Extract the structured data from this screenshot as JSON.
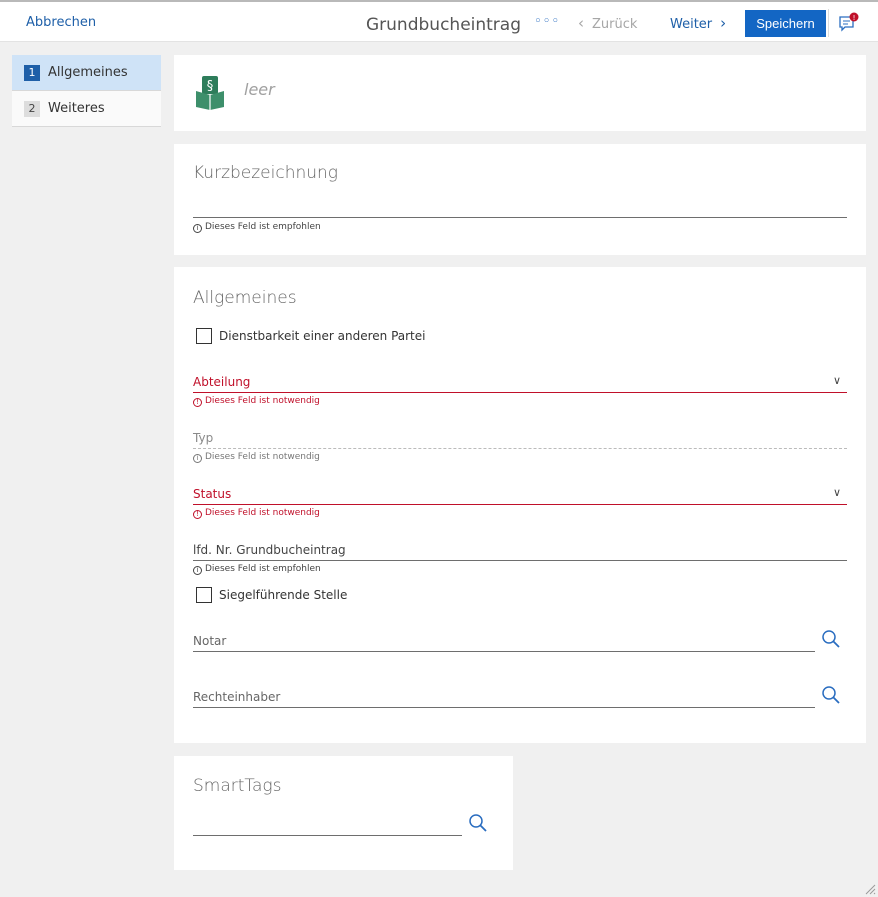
{
  "toolbar": {
    "cancel": "Abbrechen",
    "title": "Grundbucheintrag",
    "more": "◦◦◦",
    "back": "Zurück",
    "next": "Weiter",
    "save": "Speichern",
    "notification_badge": "!"
  },
  "nav": {
    "items": [
      {
        "num": "1",
        "label": "Allgemeines",
        "active": true
      },
      {
        "num": "2",
        "label": "Weiteres",
        "active": false
      }
    ]
  },
  "header_card": {
    "icon": "land-register-book-icon",
    "name_placeholder": "leer"
  },
  "short_name": {
    "title": "Kurzbezeichnung",
    "hint": "Dieses Feld ist empfohlen"
  },
  "general": {
    "title": "Allgemeines",
    "checkbox_easement": {
      "label": "Dienstbarkeit einer anderen Partei",
      "checked": false
    },
    "department": {
      "label": "Abteilung",
      "hint": "Dieses Feld ist notwendig"
    },
    "type": {
      "label": "Typ",
      "hint": "Dieses Feld ist notwendig"
    },
    "status": {
      "label": "Status",
      "hint": "Dieses Feld ist notwendig"
    },
    "entry_number": {
      "label": "lfd. Nr. Grundbucheintrag",
      "hint": "Dieses Feld ist empfohlen"
    },
    "checkbox_seal": {
      "label": "Siegelführende Stelle",
      "checked": false
    },
    "notary": {
      "label": "Notar"
    },
    "rights_holder": {
      "label": "Rechteinhaber"
    }
  },
  "smarttags": {
    "title": "SmartTags"
  },
  "colors": {
    "accent": "#1366c4",
    "error": "#c0102a",
    "link": "#1e5fa8",
    "icon_green": "#2e7d5b"
  }
}
